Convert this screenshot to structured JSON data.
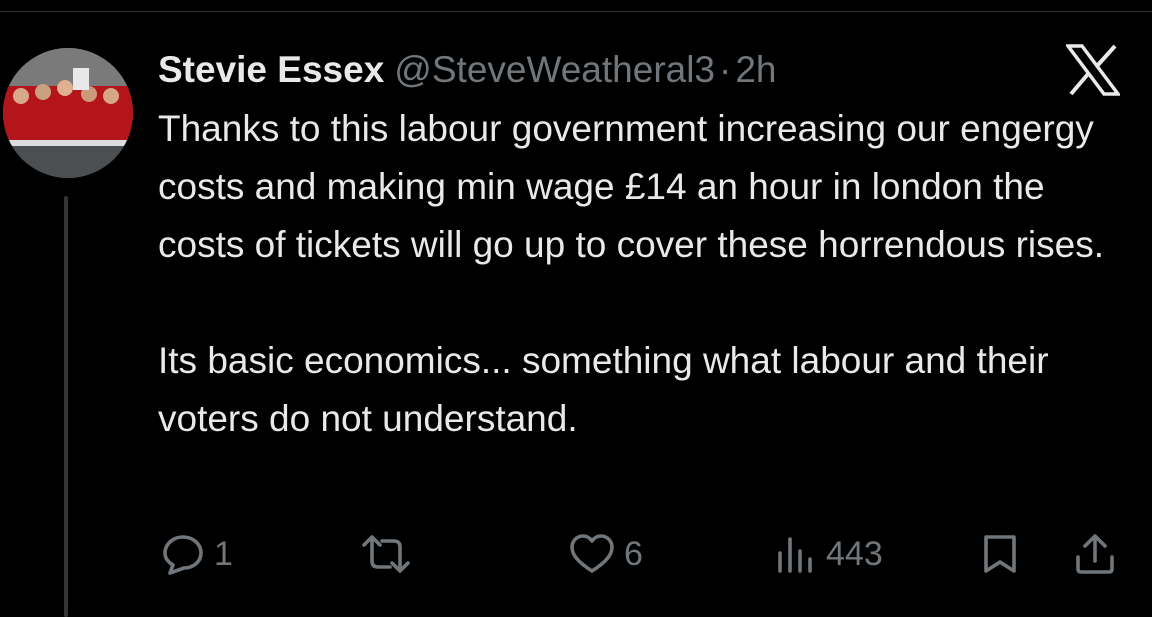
{
  "tweet": {
    "author_name": "Stevie Essex",
    "handle": "@SteveWeatheral3",
    "separator": "·",
    "time": "2h",
    "paragraphs": [
      "Thanks to this labour government increasing our engergy costs and making min wage £14 an hour in london the costs of tickets will go up to cover these horrendous rises.",
      "Its basic economics... something what labour and their voters do not understand."
    ]
  },
  "actions": {
    "replies": "1",
    "retweets": "",
    "likes": "6",
    "views": "443"
  },
  "icons": {
    "brand": "x-logo-icon",
    "reply": "reply-icon",
    "retweet": "retweet-icon",
    "like": "heart-icon",
    "views": "views-icon",
    "bookmark": "bookmark-icon",
    "share": "share-icon"
  },
  "colors": {
    "background": "#000000",
    "text": "#e7e9ea",
    "muted": "#71767b",
    "divider": "#2f3336"
  }
}
